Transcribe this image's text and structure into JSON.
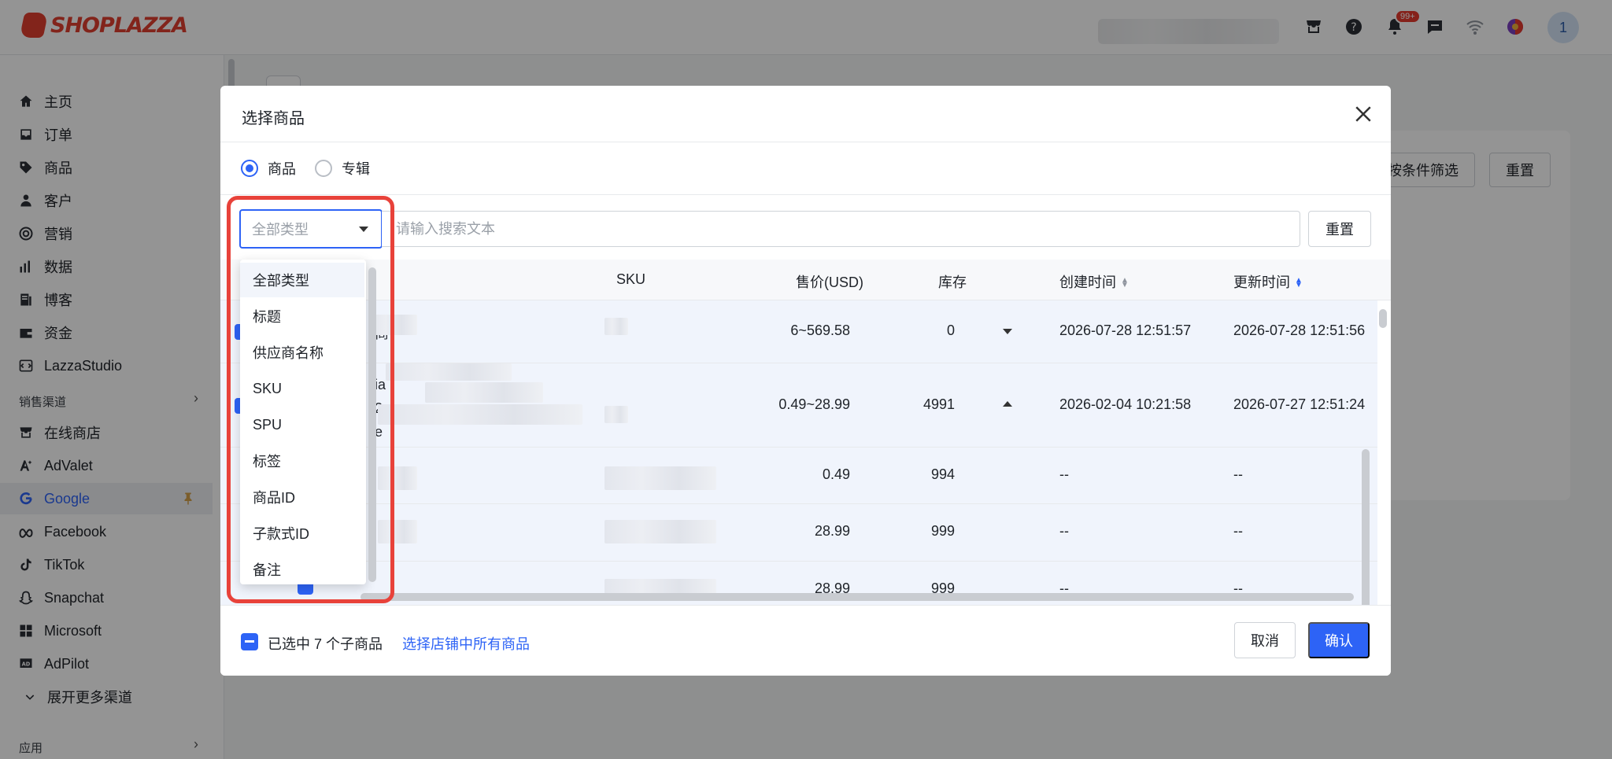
{
  "brand": {
    "name": "SHOPLAZZA"
  },
  "topbar": {
    "icons": [
      "store-icon",
      "help-icon",
      "bell-icon",
      "message-icon",
      "wifi-icon",
      "theme-icon"
    ],
    "notification_badge": "99+",
    "avatar_initial": "1"
  },
  "sidebar": {
    "items": [
      {
        "label": "主页",
        "icon": "home-icon"
      },
      {
        "label": "订单",
        "icon": "inbox-icon"
      },
      {
        "label": "商品",
        "icon": "tag-icon"
      },
      {
        "label": "客户",
        "icon": "user-icon"
      },
      {
        "label": "营销",
        "icon": "target-icon"
      },
      {
        "label": "数据",
        "icon": "bar-chart-icon"
      },
      {
        "label": "博客",
        "icon": "blog-icon"
      },
      {
        "label": "资金",
        "icon": "wallet-icon"
      },
      {
        "label": "LazzaStudio",
        "icon": "studio-icon"
      }
    ],
    "sales_channels_label": "销售渠道",
    "channels": [
      {
        "label": "在线商店",
        "icon": "store-icon"
      },
      {
        "label": "AdValet",
        "icon": "advalet-icon"
      },
      {
        "label": "Google",
        "icon": "google-icon",
        "active": true
      },
      {
        "label": "Facebook",
        "icon": "meta-icon"
      },
      {
        "label": "TikTok",
        "icon": "tiktok-icon"
      },
      {
        "label": "Snapchat",
        "icon": "snapchat-icon"
      },
      {
        "label": "Microsoft",
        "icon": "microsoft-icon"
      },
      {
        "label": "AdPilot",
        "icon": "adpilot-icon"
      }
    ],
    "expand_more_label": "展开更多渠道",
    "apps_label": "应用"
  },
  "background_page": {
    "filter_button": "按条件筛选",
    "reset_button": "重置"
  },
  "modal": {
    "title": "选择商品",
    "radio": {
      "products": "商品",
      "collections": "专辑",
      "selected": "products"
    },
    "type_select": {
      "value": "全部类型"
    },
    "search": {
      "placeholder": "请输入搜索文本"
    },
    "reset_label": "重置",
    "columns": {
      "sku": "SKU",
      "price": "售价(USD)",
      "stock": "库存",
      "created": "创建时间",
      "updated": "更新时间"
    },
    "rows": [
      {
        "name_fragment": "商",
        "price": "6~569.58",
        "stock": "0",
        "expand": "down",
        "created": "2026-07-28 12:51:57",
        "updated": "2026-07-28 12:51:56"
      },
      {
        "name_fragment": "ia\n2\ne",
        "price": "0.49~28.99",
        "stock": "4991",
        "expand": "up",
        "created": "2026-02-04 10:21:58",
        "updated": "2026-07-27 12:51:24"
      },
      {
        "price": "0.49",
        "stock": "994",
        "created": "--",
        "updated": "--"
      },
      {
        "price": "28.99",
        "stock": "999",
        "created": "--",
        "updated": "--"
      },
      {
        "price": "28.99",
        "stock": "999",
        "created": "--",
        "updated": "--"
      }
    ],
    "footer": {
      "selected_text": "已选中 7 个子商品",
      "select_all_link": "选择店铺中所有商品",
      "cancel": "取消",
      "confirm": "确认"
    }
  },
  "dropdown": {
    "options": [
      "全部类型",
      "标题",
      "供应商名称",
      "SKU",
      "SPU",
      "标签",
      "商品ID",
      "子款式ID",
      "备注"
    ],
    "selected": "全部类型"
  },
  "colors": {
    "primary": "#2d63f6",
    "highlight": "#e8423a",
    "brand": "#e03e2f"
  }
}
